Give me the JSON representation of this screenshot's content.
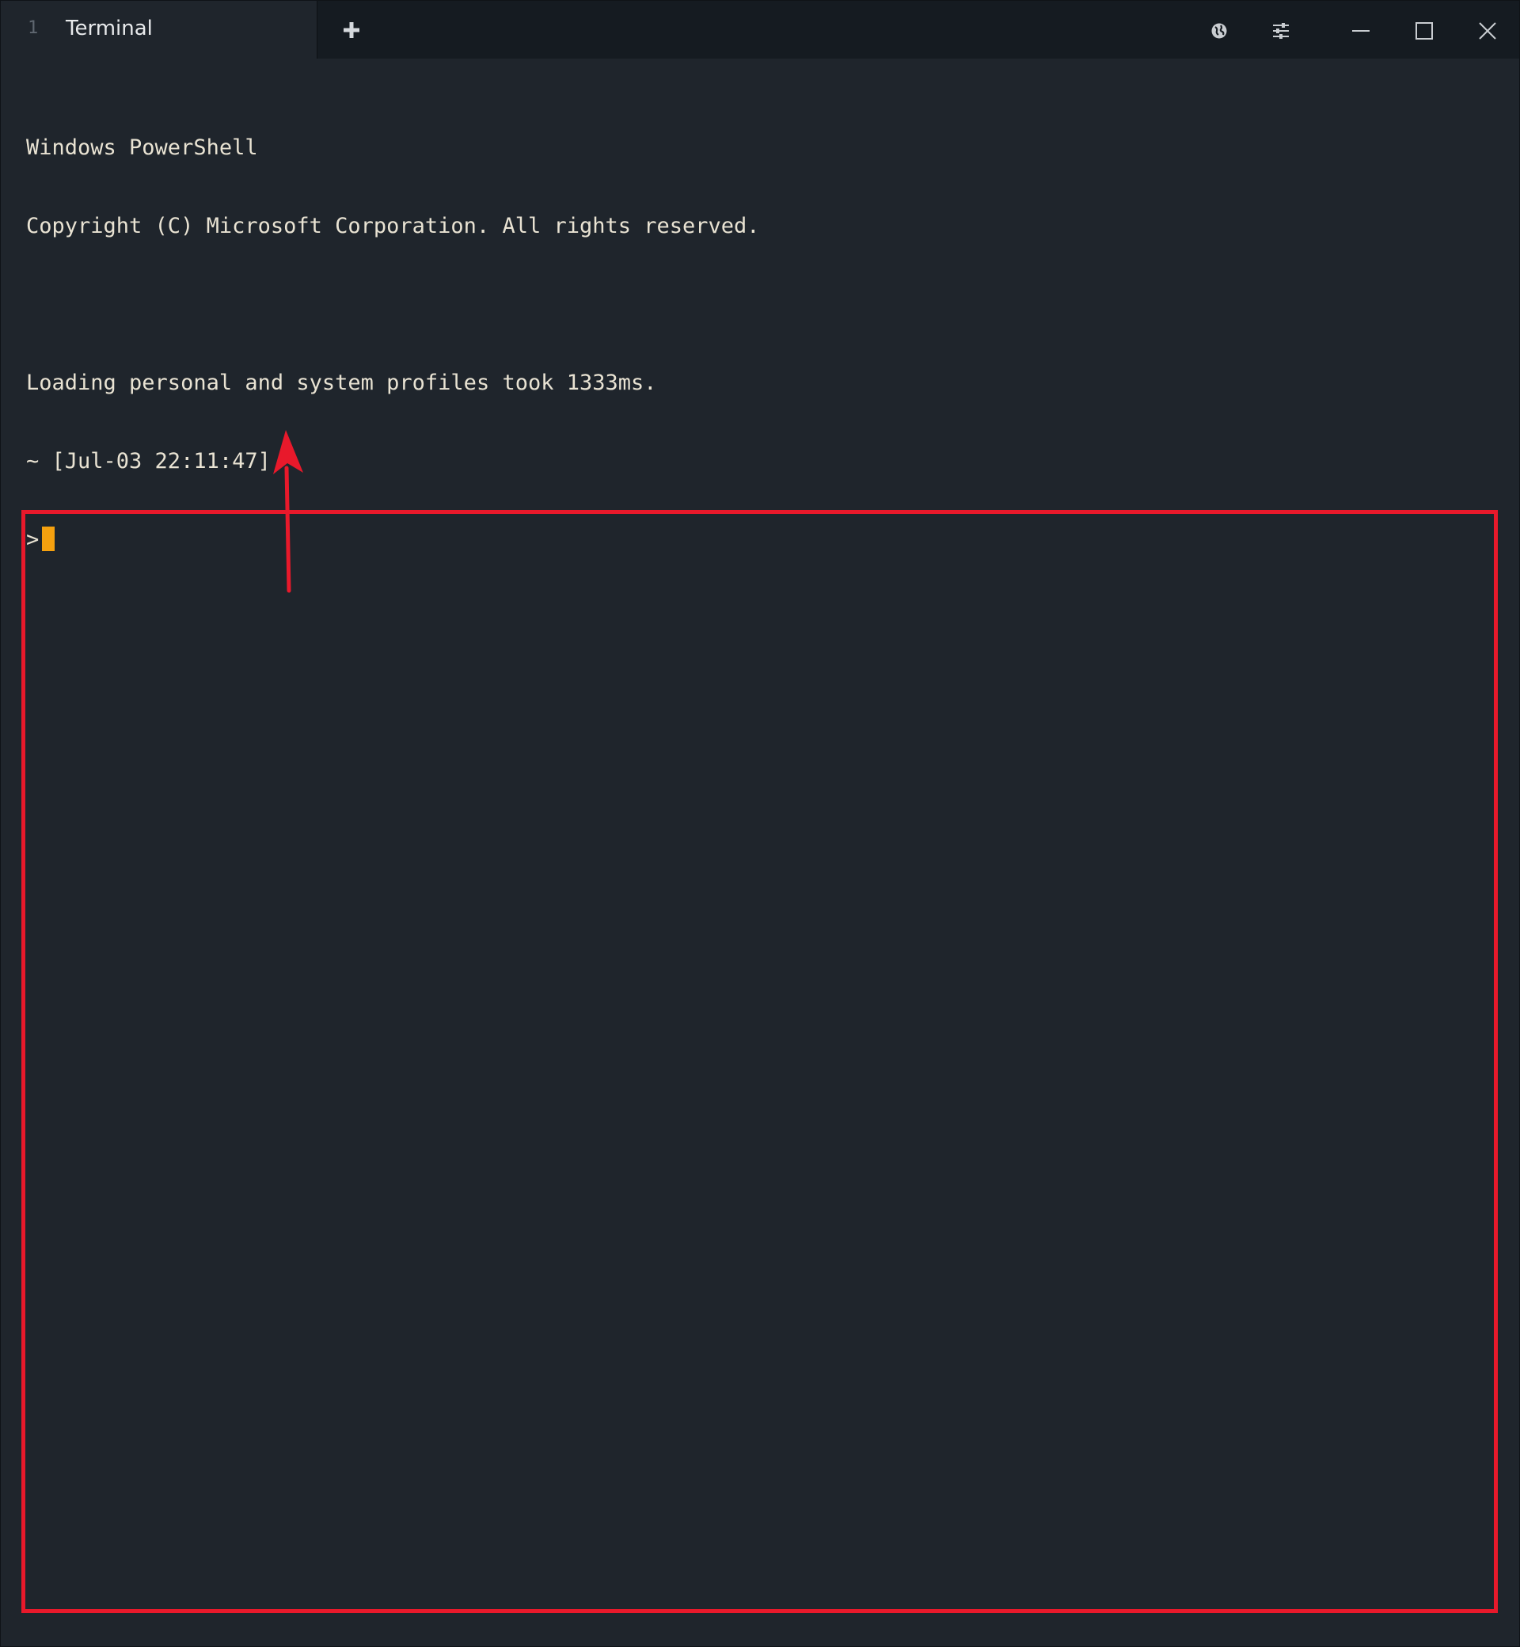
{
  "tab": {
    "index": "1",
    "title": "Terminal"
  },
  "titlebar": {
    "icons": [
      "plus-icon",
      "globe-icon",
      "sliders-icon",
      "minimize-icon",
      "maximize-icon",
      "close-icon"
    ]
  },
  "terminal": {
    "lines": [
      "Windows PowerShell",
      "Copyright (C) Microsoft Corporation. All rights reserved.",
      "",
      "Loading personal and system profiles took 1333ms.",
      "~ [Jul-03 22:11:47]"
    ],
    "prompt": ">",
    "cursor_color": "#f5a10f"
  },
  "annotation": {
    "color": "#e8192b"
  }
}
